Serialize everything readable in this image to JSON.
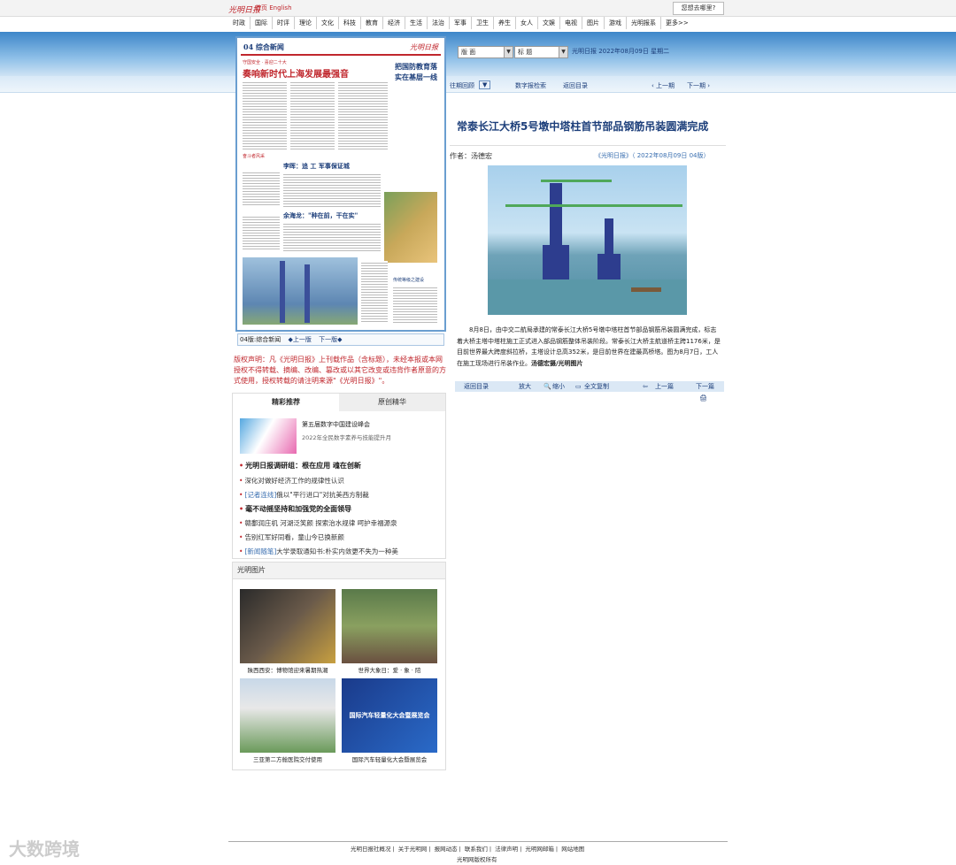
{
  "topbar": {
    "logo": "光明日报",
    "links": [
      "首页",
      "English"
    ],
    "where_button": "您想去哪里?"
  },
  "nav": [
    "时政",
    "国际",
    "时评",
    "理论",
    "文化",
    "科技",
    "教育",
    "经济",
    "生活",
    "法治",
    "军事",
    "卫生",
    "养生",
    "女人",
    "文娱",
    "电视",
    "图片",
    "游戏",
    "光明报系",
    "更多>>"
  ],
  "issue_bar": {
    "select1": "版  面",
    "select2": "标  题",
    "issue_info": "光明日报  2022年08月09日  星期二"
  },
  "band2": {
    "past": "往期回顾",
    "past_btn": "▼",
    "digital": "数字报检索",
    "home": "返回目录",
    "prev": "‹ 上一期",
    "next": "下一期 ›"
  },
  "newspaper": {
    "section": "04 综合新闻",
    "brand": "光明日报",
    "kicker1": "守国安全 · 喜迎二十大",
    "headline": "奏响新时代上海发展最强音",
    "side_title": "把国防教育落实在基层一线",
    "kicker2": "奋斗者风采",
    "h2": "李晖：追 工 军事保证城",
    "h3": "余海龙：\"种在前，干在实\"",
    "box_title": "传统等级之建设"
  },
  "paper_bar": {
    "label": "04版:综合新闻",
    "prev": "◆上一版",
    "next": "下一版◆"
  },
  "copyright": "版权声明：凡《光明日报》上刊载作品（含标题），未经本报或本网授权不得转载、摘编、改编、篡改或以其它改变或违背作者原意的方式使用，授权转载的请注明来源\"《光明日报》\"。",
  "article": {
    "title": "常泰长江大桥5号墩中塔柱首节部品钢筋吊装圆满完成",
    "author": "作者：汤德宏",
    "source": "《光明日报》（ 2022年08月09日   04版）",
    "body": "8月8日，由中交二航局承建的常泰长江大桥5号墩中塔柱首节部品钢筋吊装圆满完成，标志着大桥主塔中塔柱施工正式进入部品钢筋整体吊装阶段。常泰长江大桥主航道桥主跨1176米，是目前世界最大跨度斜拉桥，主塔设计总高352米，是目前世界在建最高桥塔。图为8月7日，工人在施工现场进行吊装作业。",
    "credit": "汤德宏摄/光明图片"
  },
  "article_toolbar": {
    "back": "返回目录",
    "enlarge": "放大",
    "shrink": "缩小",
    "copy": "全文复制",
    "prev": "上一篇",
    "next": "下一篇"
  },
  "tabs": {
    "tab1": "精彩推荐",
    "tab2": "原创精华",
    "promo_title": "第五届数字中国建设峰会",
    "promo_sub": "2022年全民数字素养与技能提升月",
    "items": [
      {
        "text": "光明日报调研组：根在应用 魂在创新",
        "bold": true
      },
      {
        "text": "深化对做好经济工作的规律性认识",
        "bold": false
      },
      {
        "tag": "[记者连线]",
        "text": "俄以\"平行进口\"对抗美西方制裁",
        "bold": false
      },
      {
        "text": "毫不动摇坚持和加强党的全面领导",
        "bold": true
      },
      {
        "text": "赣鄱润庄机 河湖泛笑颜 探索治水规律 呵护幸福源泉",
        "bold": false
      },
      {
        "text": "告别红军好同看，童山今已换新颜",
        "bold": false
      },
      {
        "tag": "[新闻随笔]",
        "text": "大学录取通知书:朴实内敛更不失为一种美",
        "bold": false
      }
    ]
  },
  "photos": {
    "head": "光明图片",
    "items": [
      "陕西西安：博物馆迎来暑期热潮",
      "世界大象日：爱 · 象 · 陪",
      "三亚第二方舱医院交付使用",
      "国际汽车轻量化大会暨展览会"
    ],
    "poster_text": "国际汽车轻量化大会暨展览会"
  },
  "footer": {
    "links": [
      "光明日报社概况",
      "关于光明网",
      "报网动态",
      "联系我们",
      "法律声明",
      "光明网邮箱",
      "网站地图"
    ],
    "copy": "光明网版权所有"
  },
  "watermark": "大数跨境"
}
